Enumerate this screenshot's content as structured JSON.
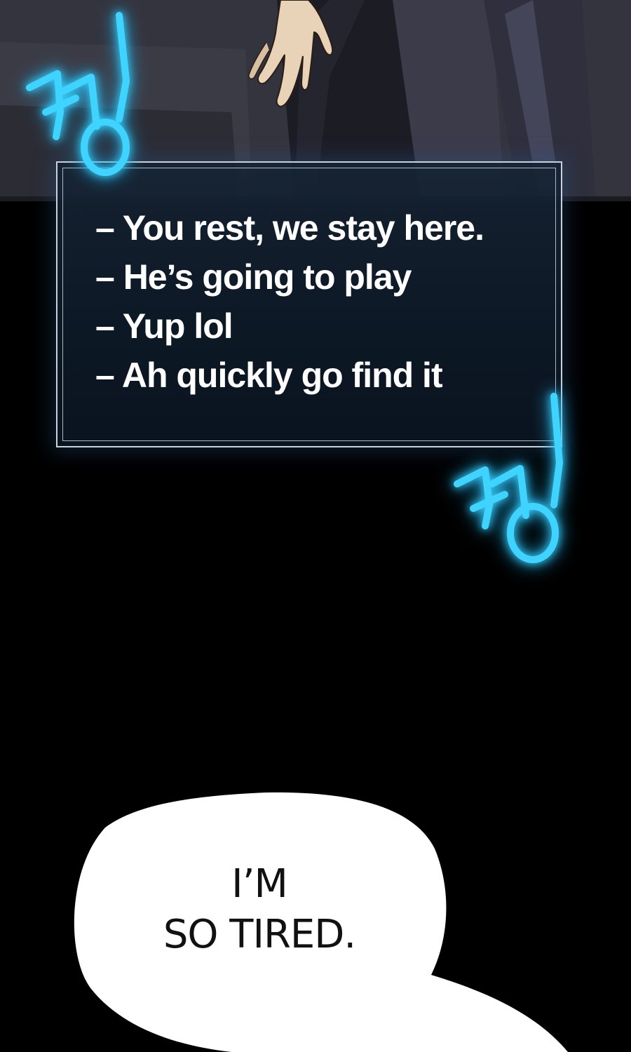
{
  "system_message": {
    "lines": [
      "– You rest, we stay here.",
      "– He’s going to play",
      "– Yup lol",
      "– Ah quickly go find it"
    ]
  },
  "speech_bubble": {
    "line1": "I’M",
    "line2": "SO TIRED."
  },
  "sound_effects": [
    {
      "icon": "ding-sfx-icon",
      "color": "#3fd4ff"
    },
    {
      "icon": "ding-sfx-icon",
      "color": "#3fd4ff"
    }
  ],
  "colors": {
    "background": "#000000",
    "sfx_glow": "#3fd4ff",
    "box_border": "#c9d2dc",
    "bubble": "#ffffff"
  }
}
